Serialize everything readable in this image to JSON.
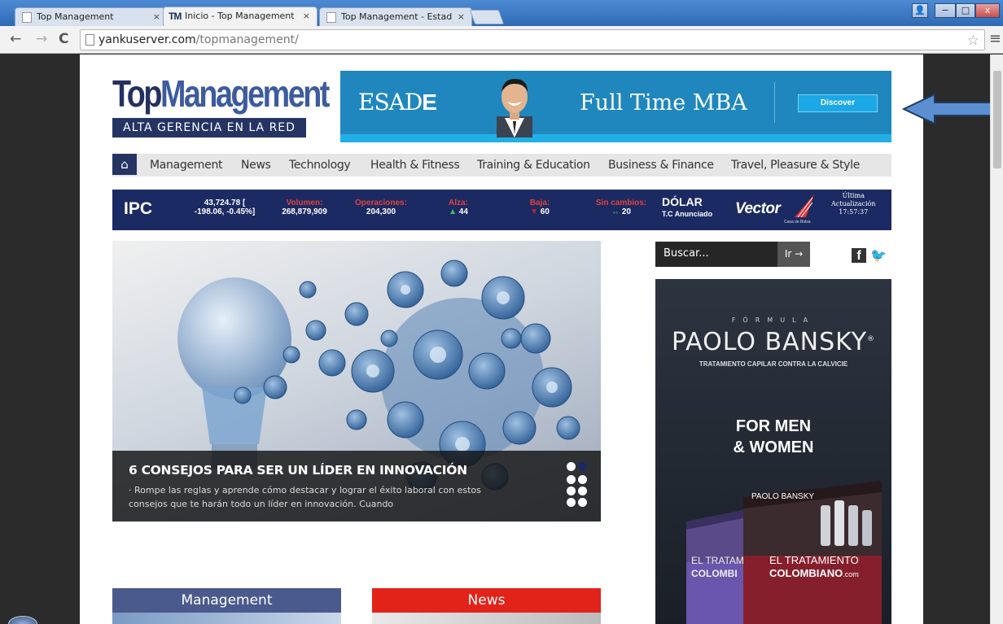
{
  "browser": {
    "tabs": [
      {
        "label": "Top Management",
        "active": false
      },
      {
        "label": "Inicio - Top Management",
        "active": true
      },
      {
        "label": "Top Management - Estad",
        "active": false
      }
    ],
    "close_glyph": "×",
    "url_host": "yankuserver.com",
    "url_path": "/topmanagement/",
    "win_controls": [
      "−",
      "□",
      "x"
    ],
    "icons": [
      "back-icon",
      "forward-icon",
      "reload-icon",
      "page-icon",
      "star-icon",
      "menu-icon"
    ]
  },
  "site": {
    "logo_top": "Top",
    "logo_mgmt": "Management",
    "logo_sub": "ALTA GERENCIA EN LA RED"
  },
  "banner_ad": {
    "brand_plain": "ESAD",
    "brand_bold": "E",
    "headline": "Full Time MBA",
    "cta": "Discover"
  },
  "nav": {
    "items": [
      "Management",
      "News",
      "Technology",
      "Health & Fitness",
      "Training & Education",
      "Business & Finance",
      "Travel, Pleasure & Style"
    ]
  },
  "ticker": {
    "index_name": "IPC",
    "value": "43,724.78 [",
    "change": "-198.06, -0.45%]",
    "volumen_label": "Volumen:",
    "volumen": "268,879,909",
    "operaciones_label": "Operaciones:",
    "operaciones": "204,300",
    "alza_label": "Alza:",
    "alza": "44",
    "baja_label": "Baja:",
    "baja": "60",
    "sin_cambios_label": "Sin cambios:",
    "sin_cambios": "20",
    "dolar": "DÓLAR",
    "dolar_sub": "T.C Anunciado",
    "vector": "Vector",
    "casa": "Casa de Bolsa",
    "ultima_1": "Última",
    "ultima_2": "Actualización",
    "time": "17:57:37",
    "colors": {
      "label": "#e2433a",
      "up": "#3ec35b",
      "down": "#c82020"
    }
  },
  "hero": {
    "title": "6 CONSEJOS PARA SER UN LÍDER EN INNOVACIÓN",
    "excerpt": "· Rompe las reglas y aprende cómo destacar y lograr el éxito laboral con estos consejos que te harán todo un líder en innovación. Cuando"
  },
  "sidebar": {
    "search_placeholder": "Buscar...",
    "search_button": "Ir →",
    "social_f": "f",
    "social_t": "🐦"
  },
  "side_ad": {
    "formula": "FÓRMULA",
    "brand": "PAOLO BANSKY",
    "registered": "®",
    "tagline": "TRATAMIENTO CAPILAR CONTRA LA CALVICIE",
    "formen_1": "FOR MEN",
    "formen_2": "& WOMEN",
    "box_brand": "PAOLO BANSKY",
    "box_line1": "EL TRATAMIENTO",
    "box_line2": "COLOMBIANO",
    "box_line2_suffix": ".com",
    "box_left_line1": "EL TRATAM",
    "box_left_line2": "COLOMBI"
  },
  "sections": [
    {
      "label": "Management",
      "color": "#4a5a8c"
    },
    {
      "label": "News",
      "color": "#e2231a"
    }
  ]
}
